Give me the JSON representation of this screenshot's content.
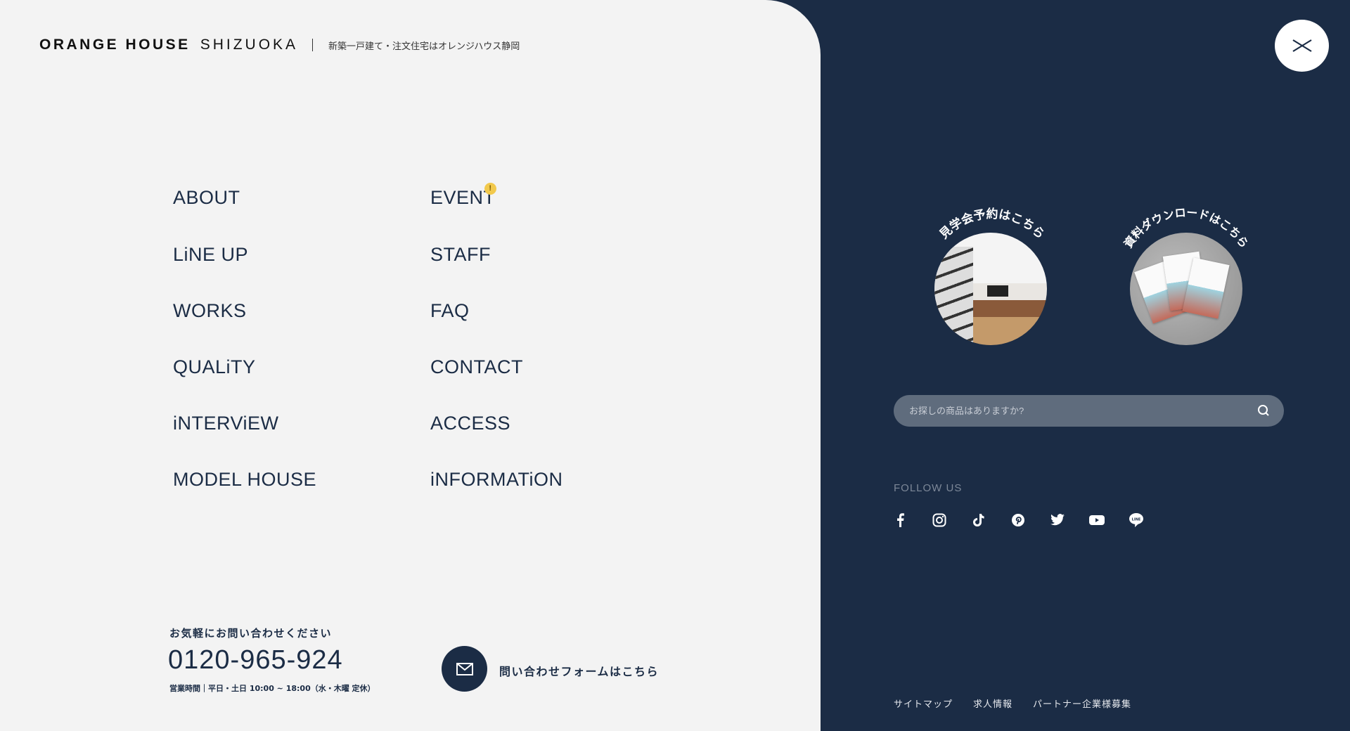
{
  "header": {
    "brand_bold": "ORANGE HOUSE",
    "brand_light": "SHIZUOKA",
    "tagline": "新築一戸建て・注文住宅はオレンジハウス静岡"
  },
  "nav": {
    "col1": [
      "ABOUT",
      "LiNE UP",
      "WORKS",
      "QUALiTY",
      "iNTERViEW",
      "MODEL HOUSE"
    ],
    "col2": [
      "EVENT",
      "STAFF",
      "FAQ",
      "CONTACT",
      "ACCESS",
      "iNFORMATiON"
    ],
    "event_badge": "!"
  },
  "contact": {
    "label": "お気軽にお問い合わせください",
    "phone": "0120-965-924",
    "hours": "営業時間｜平日・土日 10:00 ~ 18:00（水・木曜 定休）",
    "form_label": "問い合わせフォームはこちら"
  },
  "promo": {
    "visit": "見学会予約はこちら",
    "download": "資料ダウンロードはこちら"
  },
  "search": {
    "placeholder": "お探しの商品はありますか?",
    "value": ""
  },
  "follow": {
    "label": "FOLLOW US",
    "icons": [
      "facebook-icon",
      "instagram-icon",
      "tiktok-icon",
      "pinterest-icon",
      "twitter-icon",
      "youtube-icon",
      "line-icon"
    ]
  },
  "footer": {
    "links": [
      "サイトマップ",
      "求人情報",
      "パートナー企業様募集"
    ]
  },
  "colors": {
    "navy": "#1b2c45",
    "panel": "#f3f3f3",
    "badge": "#f2c94c",
    "search": "#5f6c7d"
  }
}
